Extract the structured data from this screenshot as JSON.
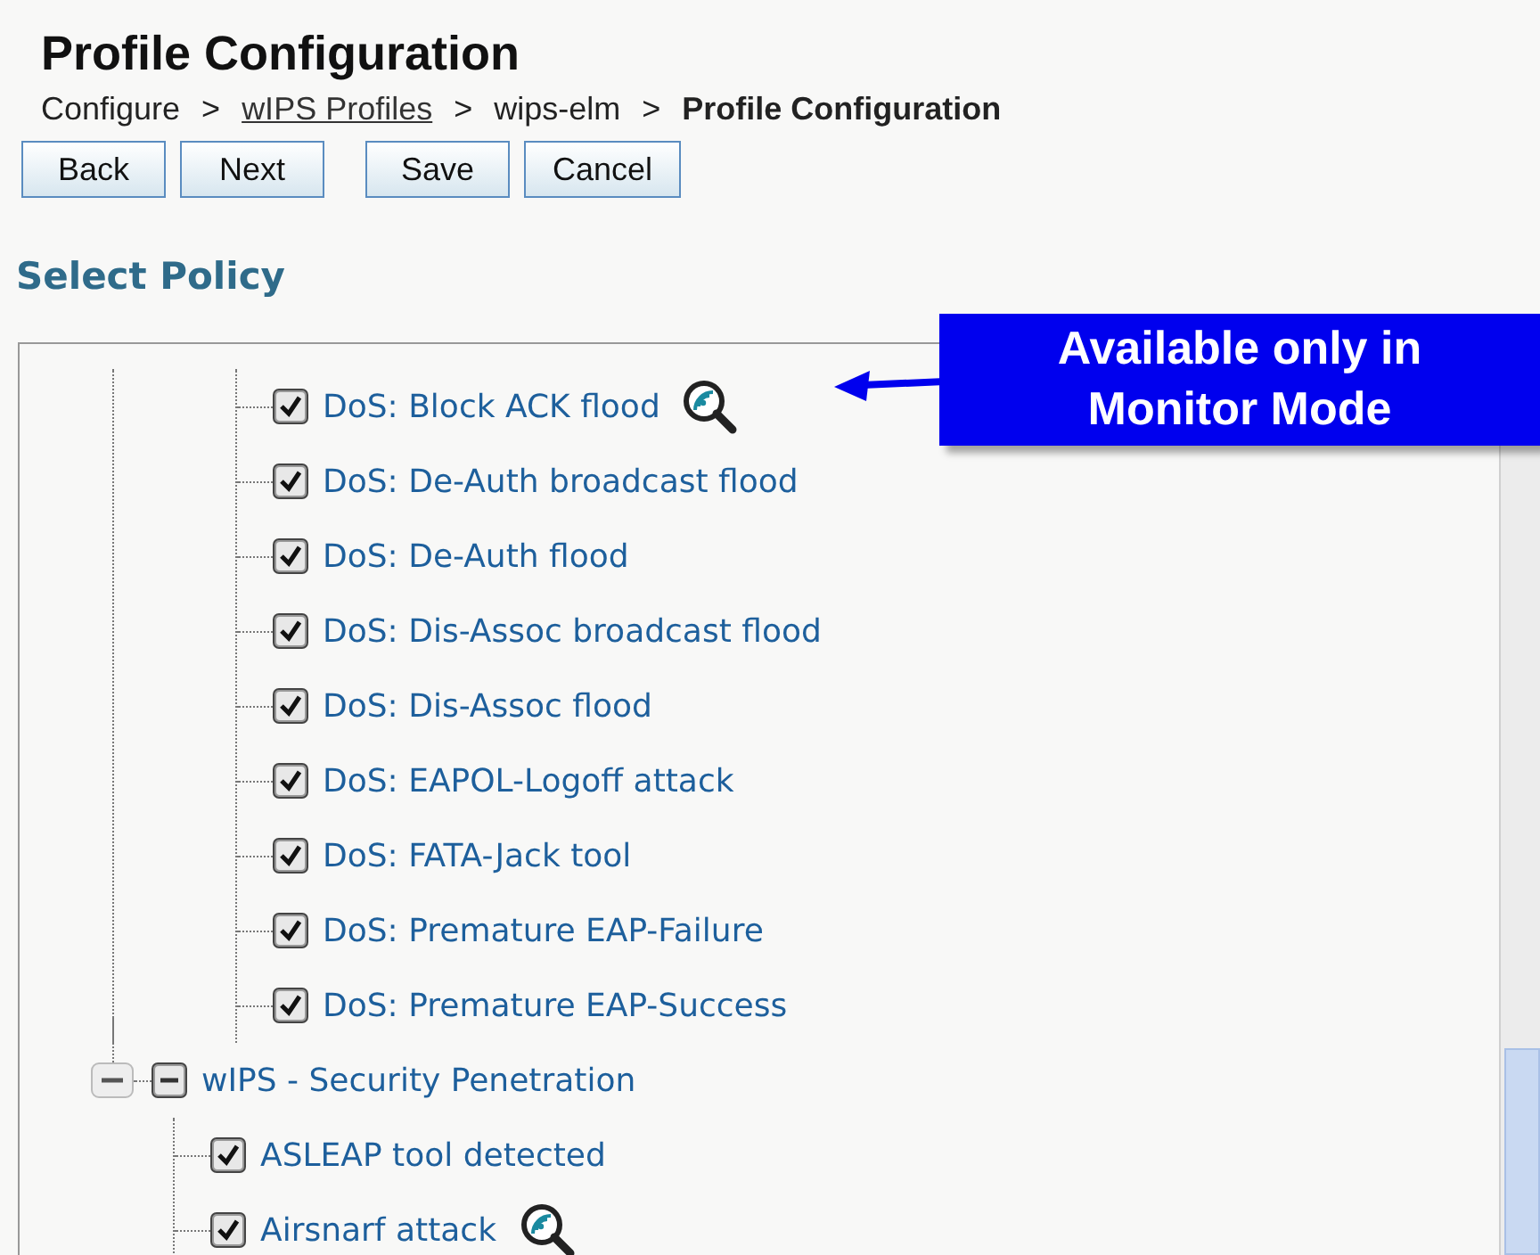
{
  "page": {
    "title": "Profile Configuration"
  },
  "breadcrumb": [
    {
      "label": "Configure",
      "kind": "text"
    },
    {
      "label": "wIPS Profiles",
      "kind": "link"
    },
    {
      "label": "wips-elm",
      "kind": "text"
    },
    {
      "label": "Profile Configuration",
      "kind": "current"
    }
  ],
  "breadcrumb_separator": ">",
  "buttons": [
    {
      "label": "Back"
    },
    {
      "label": "Next"
    },
    {
      "label": "Save"
    },
    {
      "label": "Cancel"
    }
  ],
  "section_title": "Select Policy",
  "tree": [
    {
      "children": [
        {
          "label": "DoS: Block ACK flood",
          "checked": true,
          "monitor_only": true
        },
        {
          "label": "DoS: De-Auth broadcast flood",
          "checked": true,
          "monitor_only": false
        },
        {
          "label": "DoS: De-Auth flood",
          "checked": true,
          "monitor_only": false
        },
        {
          "label": "DoS: Dis-Assoc broadcast flood",
          "checked": true,
          "monitor_only": false
        },
        {
          "label": "DoS: Dis-Assoc flood",
          "checked": true,
          "monitor_only": false
        },
        {
          "label": "DoS: EAPOL-Logoff attack",
          "checked": true,
          "monitor_only": false
        },
        {
          "label": "DoS: FATA-Jack tool",
          "checked": true,
          "monitor_only": false
        },
        {
          "label": "DoS: Premature EAP-Failure",
          "checked": true,
          "monitor_only": false
        },
        {
          "label": "DoS: Premature EAP-Success",
          "checked": true,
          "monitor_only": false
        }
      ]
    },
    {
      "label": "wIPS - Security Penetration",
      "partial": true,
      "expanded": true,
      "children": [
        {
          "label": "ASLEAP tool detected",
          "checked": true,
          "monitor_only": false
        },
        {
          "label": "Airsnarf attack",
          "checked": true,
          "monitor_only": true
        }
      ]
    }
  ],
  "callout": {
    "text": "Available only in Monitor Mode"
  }
}
